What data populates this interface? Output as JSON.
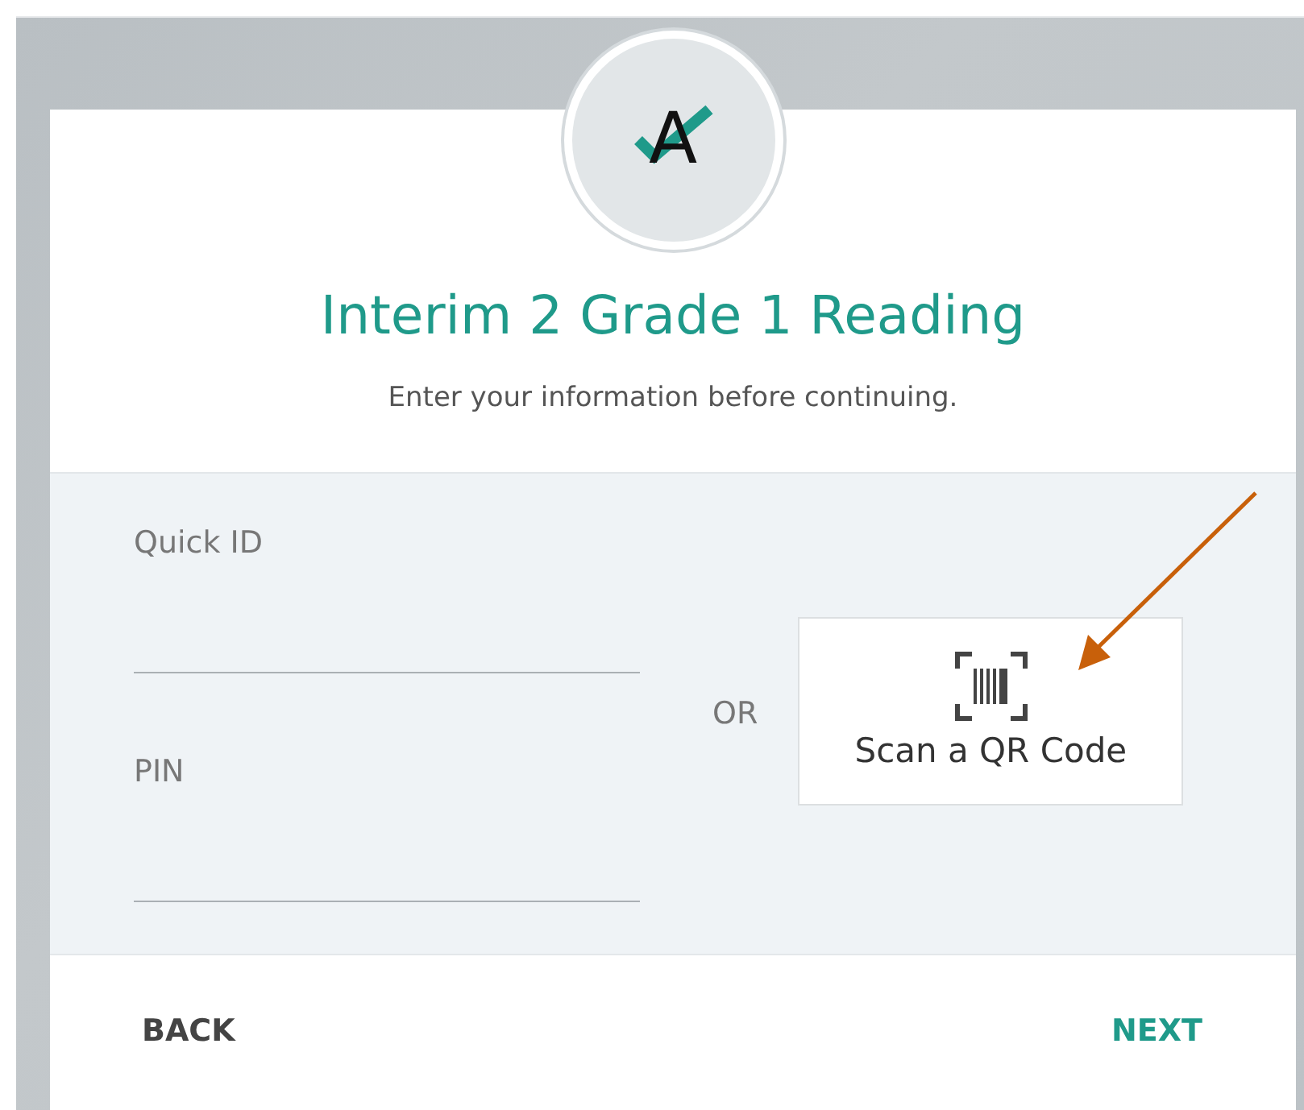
{
  "logo": {
    "letter": "A"
  },
  "title": "Interim 2 Grade 1 Reading",
  "subtitle": "Enter your information before continuing.",
  "fields": [
    {
      "label": "Quick ID"
    },
    {
      "label": "PIN"
    }
  ],
  "separator": "OR",
  "scan_button": {
    "label": "Scan a QR Code"
  },
  "annotation": {
    "kind": "arrow"
  },
  "footer": {
    "back": "BACK",
    "next": "NEXT"
  }
}
